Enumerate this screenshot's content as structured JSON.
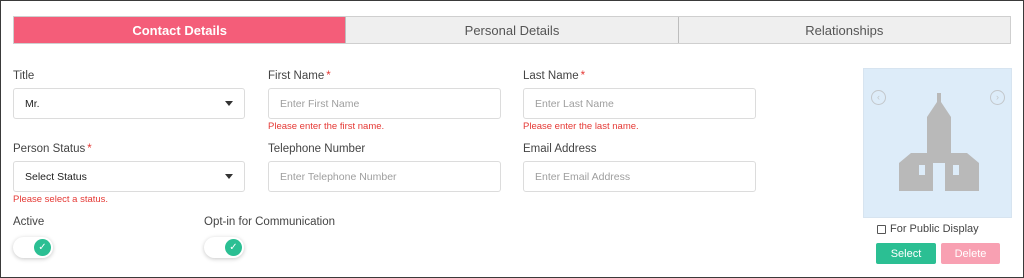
{
  "tabs": [
    {
      "label": "Contact Details",
      "active": true
    },
    {
      "label": "Personal Details",
      "active": false
    },
    {
      "label": "Relationships",
      "active": false
    }
  ],
  "form": {
    "title": {
      "label": "Title",
      "value": "Mr."
    },
    "first_name": {
      "label": "First Name",
      "required_mark": "*",
      "placeholder": "Enter First Name",
      "error": "Please enter the first name."
    },
    "last_name": {
      "label": "Last Name",
      "required_mark": "*",
      "placeholder": "Enter Last Name",
      "error": "Please enter the last name."
    },
    "person_status": {
      "label": "Person Status",
      "required_mark": "*",
      "value": "Select Status",
      "error": "Please select a status."
    },
    "telephone": {
      "label": "Telephone Number",
      "placeholder": "Enter Telephone Number"
    },
    "email": {
      "label": "Email Address",
      "placeholder": "Enter Email Address"
    },
    "active": {
      "label": "Active",
      "checked": true
    },
    "opt_in": {
      "label": "Opt-in for Communication",
      "checked": true
    }
  },
  "photo": {
    "public_display_label": "For Public Display",
    "public_display_checked": false,
    "select_label": "Select",
    "delete_label": "Delete",
    "placeholder_icon": "church-icon"
  },
  "colors": {
    "accent": "#f45d79",
    "success": "#2bbf93",
    "danger_light": "#f8a0b2",
    "error": "#e53935",
    "photo_bg": "#ddecf9"
  }
}
